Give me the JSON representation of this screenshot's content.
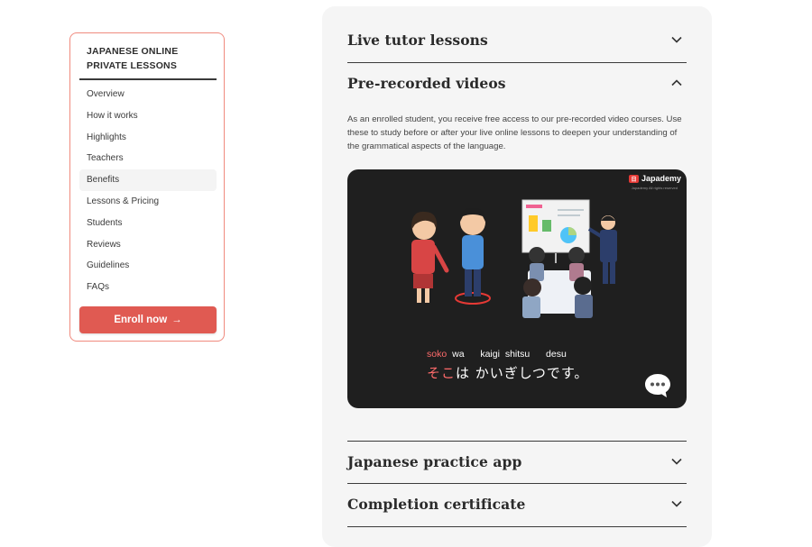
{
  "sidebar": {
    "title": "JAPANESE ONLINE PRIVATE LESSONS",
    "items": [
      {
        "label": "Overview"
      },
      {
        "label": "How it works"
      },
      {
        "label": "Highlights"
      },
      {
        "label": "Teachers"
      },
      {
        "label": "Benefits"
      },
      {
        "label": "Lessons & Pricing"
      },
      {
        "label": "Students"
      },
      {
        "label": "Reviews"
      },
      {
        "label": "Guidelines"
      },
      {
        "label": "FAQs"
      }
    ],
    "active_item": "Benefits",
    "enroll_label": "Enroll now",
    "enroll_arrow": "→"
  },
  "accordion": {
    "items": [
      {
        "title": "Live tutor lessons",
        "expanded": false
      },
      {
        "title": "Pre-recorded videos",
        "expanded": true
      },
      {
        "title": "Japanese practice app",
        "expanded": false
      },
      {
        "title": "Completion certificate",
        "expanded": false
      }
    ],
    "description": "As an enrolled student, you receive free access to our pre-recorded video courses. Use these to study before or after your live online lessons to deepen your understanding of the grammatical aspects of the language."
  },
  "video": {
    "brand": "Japademy",
    "brand_sub": "Japademy All rights reserved",
    "romaji": [
      "soko",
      "wa",
      "kaigi shitsu",
      "desu"
    ],
    "kana_highlight": "そこ",
    "kana_rest": "は かいぎしつです。"
  },
  "colors": {
    "accent": "#e05a52",
    "sidebar_border": "#f08a7e",
    "panel_bg": "#f5f5f5",
    "video_bg": "#1f1f1f"
  },
  "icons": {
    "collapsed": "chevron-down-icon",
    "expanded": "chevron-up-icon",
    "chat": "chat-bubble-icon"
  }
}
